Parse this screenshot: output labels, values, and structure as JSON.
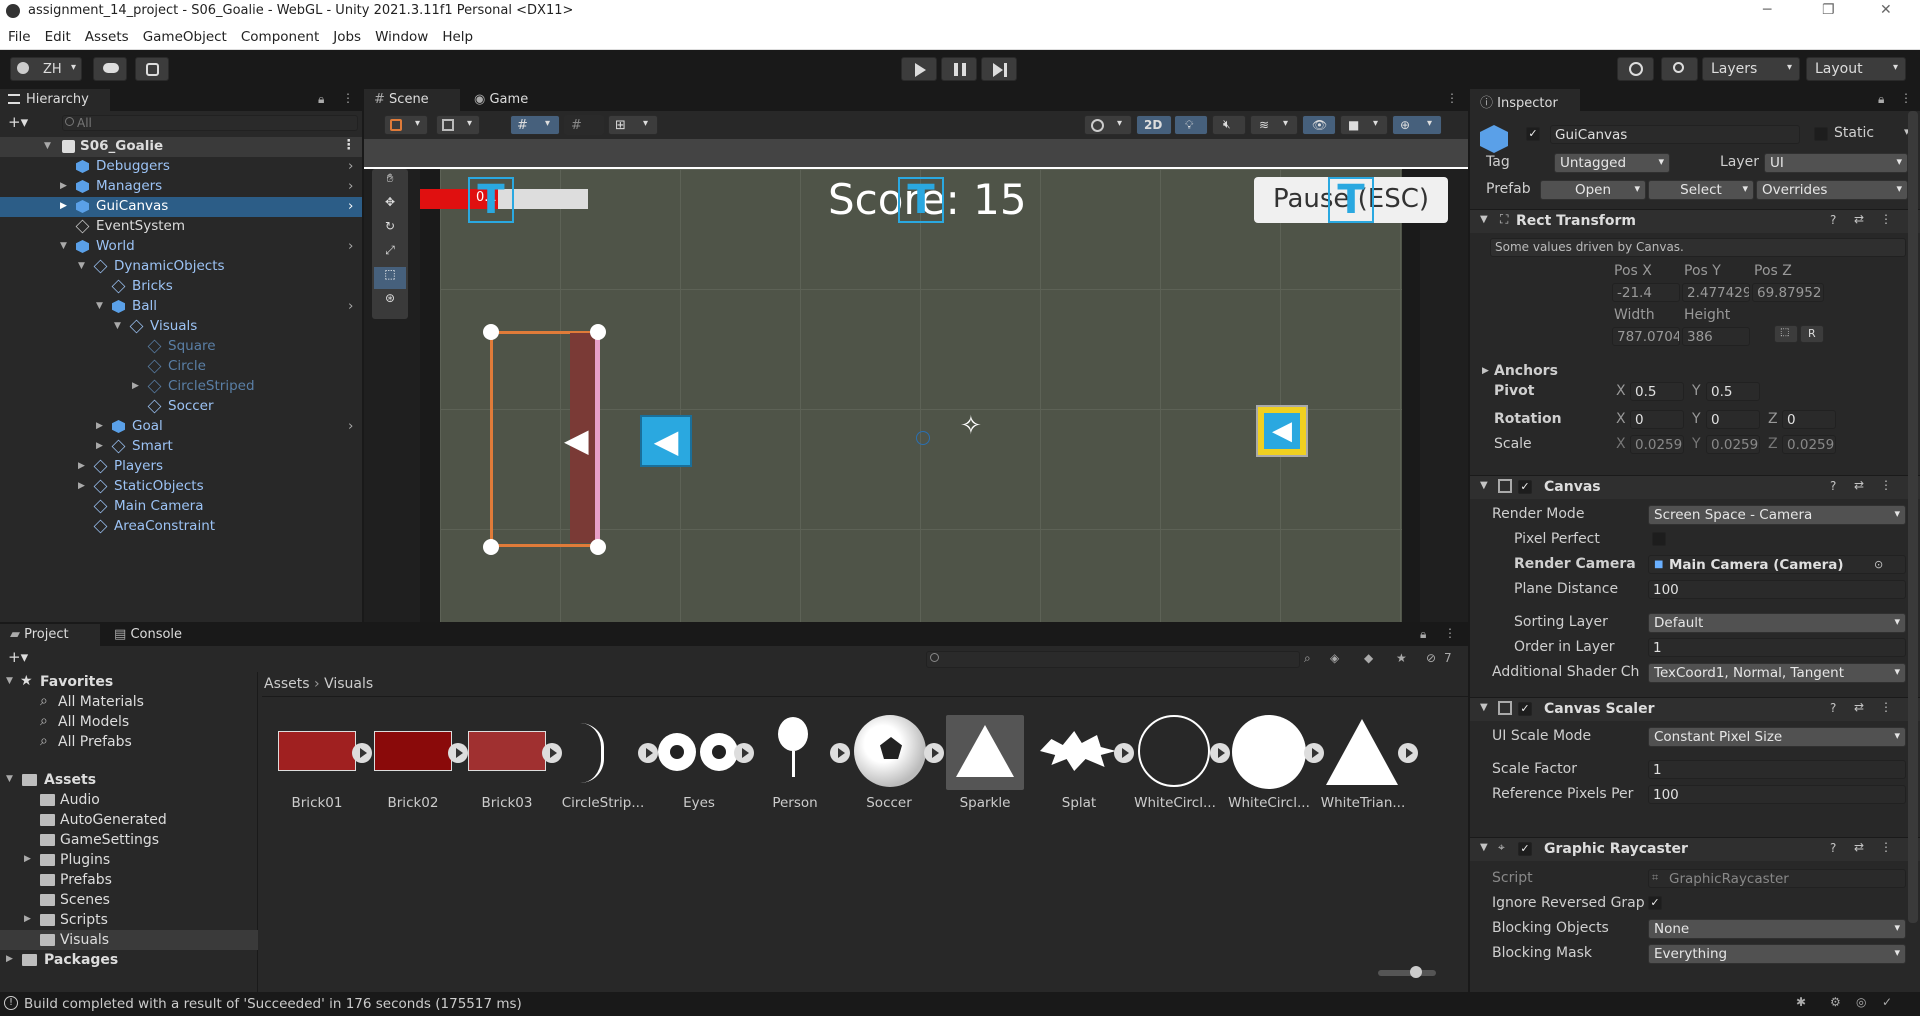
{
  "window": {
    "title": "assignment_14_project - S06_Goalie - WebGL - Unity 2021.3.11f1 Personal <DX11>"
  },
  "menu": [
    "File",
    "Edit",
    "Assets",
    "GameObject",
    "Component",
    "Jobs",
    "Window",
    "Help"
  ],
  "toolbar": {
    "account": "ZH",
    "layers": "Layers",
    "layout": "Layout"
  },
  "hierarchy": {
    "tab": "Hierarchy",
    "search_placeholder": "All",
    "rows": [
      {
        "label": "S06_Goalie",
        "depth": 0
      },
      {
        "label": "Debuggers",
        "depth": 1
      },
      {
        "label": "Managers",
        "depth": 1
      },
      {
        "label": "GuiCanvas",
        "depth": 1
      },
      {
        "label": "EventSystem",
        "depth": 1
      },
      {
        "label": "World",
        "depth": 1
      },
      {
        "label": "DynamicObjects",
        "depth": 2
      },
      {
        "label": "Bricks",
        "depth": 3
      },
      {
        "label": "Ball",
        "depth": 3
      },
      {
        "label": "Visuals",
        "depth": 4
      },
      {
        "label": "Square",
        "depth": 5
      },
      {
        "label": "Circle",
        "depth": 5
      },
      {
        "label": "CircleStriped",
        "depth": 5
      },
      {
        "label": "Soccer",
        "depth": 5
      },
      {
        "label": "Goal",
        "depth": 3
      },
      {
        "label": "Smart",
        "depth": 3
      },
      {
        "label": "Players",
        "depth": 2
      },
      {
        "label": "StaticObjects",
        "depth": 2
      },
      {
        "label": "Main Camera",
        "depth": 2
      },
      {
        "label": "AreaConstraint",
        "depth": 2
      }
    ]
  },
  "scene": {
    "tab_scene": "Scene",
    "tab_game": "Game",
    "mode2d": "2D",
    "score": "Score: 15",
    "pause": "Pause (ESC)",
    "bar_text": "0.1"
  },
  "inspector": {
    "tab": "Inspector",
    "object_name": "GuiCanvas",
    "static": "Static",
    "tag_label": "Tag",
    "tag": "Untagged",
    "layer_label": "Layer",
    "layer": "UI",
    "prefab_label": "Prefab",
    "open": "Open",
    "select": "Select",
    "overrides": "Overrides",
    "rect": {
      "title": "Rect Transform",
      "note": "Some values driven by Canvas.",
      "posx_l": "Pos X",
      "posy_l": "Pos Y",
      "posz_l": "Pos Z",
      "posx": "-21.4",
      "posy": "2.477429",
      "posz": "69.87952",
      "w_l": "Width",
      "h_l": "Height",
      "w": "787.0704",
      "h": "386",
      "anchors": "Anchors",
      "pivot": "Pivot",
      "pivot_x": "0.5",
      "pivot_y": "0.5",
      "rotation": "Rotation",
      "rx": "0",
      "ry": "0",
      "rz": "0",
      "scale": "Scale",
      "sx": "0.02590",
      "sy": "0.02590",
      "sz": "0.02590"
    },
    "canvas": {
      "title": "Canvas",
      "render_mode_l": "Render Mode",
      "render_mode": "Screen Space - Camera",
      "pixel_perfect": "Pixel Perfect",
      "render_cam_l": "Render Camera",
      "render_cam": "Main Camera (Camera)",
      "plane_l": "Plane Distance",
      "plane": "100",
      "sort_l": "Sorting Layer",
      "sort": "Default",
      "order_l": "Order in Layer",
      "order": "1",
      "shader_l": "Additional Shader Ch",
      "shader": "TexCoord1, Normal, Tangent"
    },
    "scaler": {
      "title": "Canvas Scaler",
      "mode_l": "UI Scale Mode",
      "mode": "Constant Pixel Size",
      "factor_l": "Scale Factor",
      "factor": "1",
      "ref_l": "Reference Pixels Per",
      "ref": "100"
    },
    "raycaster": {
      "title": "Graphic Raycaster",
      "script_l": "Script",
      "script": "GraphicRaycaster",
      "ignore_l": "Ignore Reversed Grap",
      "block_l": "Blocking Objects",
      "block": "None",
      "mask_l": "Blocking Mask",
      "mask": "Everything"
    }
  },
  "project": {
    "tab_project": "Project",
    "tab_console": "Console",
    "hidden_count": "7",
    "breadcrumb_root": "Assets",
    "breadcrumb_leaf": "Visuals",
    "favorites": "Favorites",
    "fav_items": [
      "All Materials",
      "All Models",
      "All Prefabs"
    ],
    "assets": "Assets",
    "folders": [
      "Audio",
      "AutoGenerated",
      "GameSettings",
      "Plugins",
      "Prefabs",
      "Scenes",
      "Scripts",
      "Visuals"
    ],
    "packages": "Packages",
    "items": [
      "Brick01",
      "Brick02",
      "Brick03",
      "CircleStrip...",
      "Eyes",
      "Person",
      "Soccer",
      "Sparkle",
      "Splat",
      "WhiteCircl...",
      "WhiteCircl...",
      "WhiteTrian..."
    ]
  },
  "status": {
    "message": "Build completed with a result of 'Succeeded' in 176 seconds (175517 ms)"
  }
}
